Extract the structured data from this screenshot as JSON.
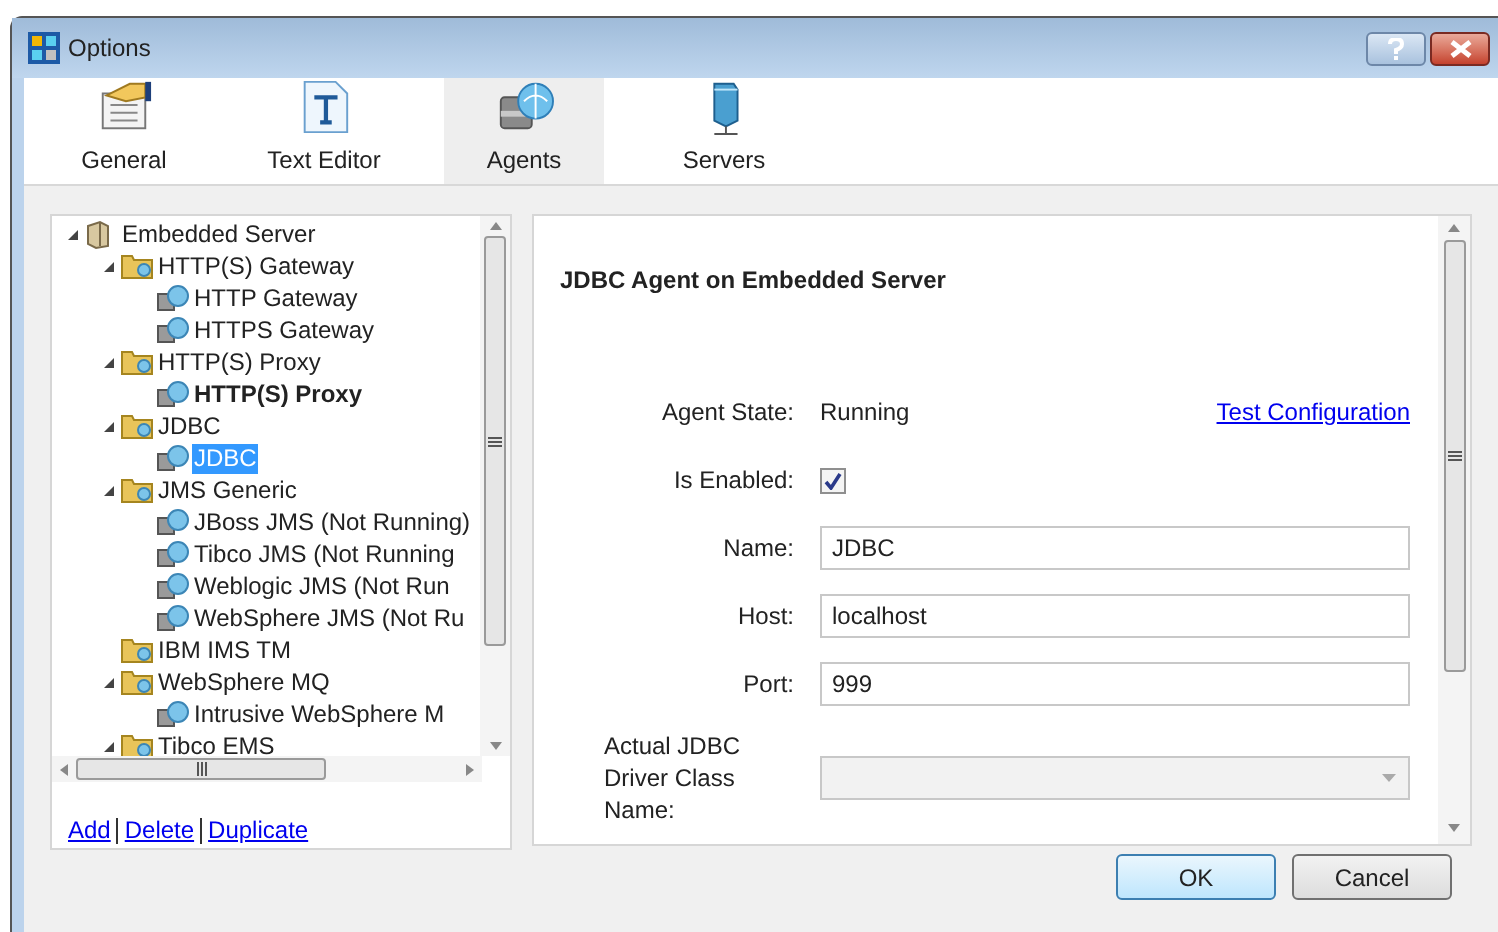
{
  "window": {
    "title": "Options"
  },
  "tabs": [
    {
      "label": "General",
      "selected": false,
      "kind": "general"
    },
    {
      "label": "Text Editor",
      "selected": false,
      "kind": "text"
    },
    {
      "label": "Agents",
      "selected": true,
      "kind": "agents"
    },
    {
      "label": "Servers",
      "selected": false,
      "kind": "servers"
    }
  ],
  "tree": [
    {
      "label": "Embedded Server",
      "kind": "server",
      "expanded": true,
      "selected": false,
      "bold": false,
      "children": [
        {
          "label": "HTTP(S) Gateway",
          "kind": "folder",
          "expanded": true,
          "selected": false,
          "bold": false,
          "children": [
            {
              "label": "HTTP Gateway",
              "kind": "agent",
              "selected": false,
              "bold": false
            },
            {
              "label": "HTTPS Gateway",
              "kind": "agent",
              "selected": false,
              "bold": false
            }
          ]
        },
        {
          "label": "HTTP(S) Proxy",
          "kind": "folder",
          "expanded": true,
          "selected": false,
          "bold": false,
          "children": [
            {
              "label": "HTTP(S) Proxy",
              "kind": "agent",
              "selected": false,
              "bold": true
            }
          ]
        },
        {
          "label": "JDBC",
          "kind": "folder",
          "expanded": true,
          "selected": false,
          "bold": false,
          "children": [
            {
              "label": "JDBC",
              "kind": "agent",
              "selected": true,
              "bold": false
            }
          ]
        },
        {
          "label": "JMS Generic",
          "kind": "folder",
          "expanded": true,
          "selected": false,
          "bold": false,
          "children": [
            {
              "label": "JBoss JMS (Not Running)",
              "kind": "agent",
              "selected": false,
              "bold": false
            },
            {
              "label": "Tibco JMS (Not Running",
              "kind": "agent",
              "selected": false,
              "bold": false
            },
            {
              "label": "Weblogic JMS (Not Run",
              "kind": "agent",
              "selected": false,
              "bold": false
            },
            {
              "label": "WebSphere JMS (Not Ru",
              "kind": "agent",
              "selected": false,
              "bold": false
            }
          ]
        },
        {
          "label": "IBM IMS TM",
          "kind": "folder",
          "expanded": false,
          "selected": false,
          "bold": false
        },
        {
          "label": "WebSphere MQ",
          "kind": "folder",
          "expanded": true,
          "selected": false,
          "bold": false,
          "children": [
            {
              "label": "Intrusive WebSphere M",
              "kind": "agent",
              "selected": false,
              "bold": false
            }
          ]
        },
        {
          "label": "Tibco EMS",
          "kind": "folder",
          "expanded": true,
          "selected": false,
          "bold": false
        }
      ]
    }
  ],
  "tree_links": [
    "Add",
    "Delete",
    "Duplicate"
  ],
  "panel": {
    "heading": "JDBC Agent on Embedded Server",
    "fields": [
      {
        "kind": "status",
        "label": "Agent State:",
        "value": "Running",
        "link": "Test Configuration"
      },
      {
        "kind": "checkbox",
        "label": "Is Enabled:",
        "checked": true
      },
      {
        "kind": "text",
        "label": "Name:",
        "value": "JDBC"
      },
      {
        "kind": "text",
        "label": "Host:",
        "value": "localhost"
      },
      {
        "kind": "text",
        "label": "Port:",
        "value": "999"
      },
      {
        "kind": "dropdown",
        "label": "Actual JDBC Driver Class Name:",
        "disabled": true
      }
    ]
  },
  "buttons": [
    {
      "label": "OK",
      "default": true
    },
    {
      "label": "Cancel",
      "default": false
    }
  ]
}
